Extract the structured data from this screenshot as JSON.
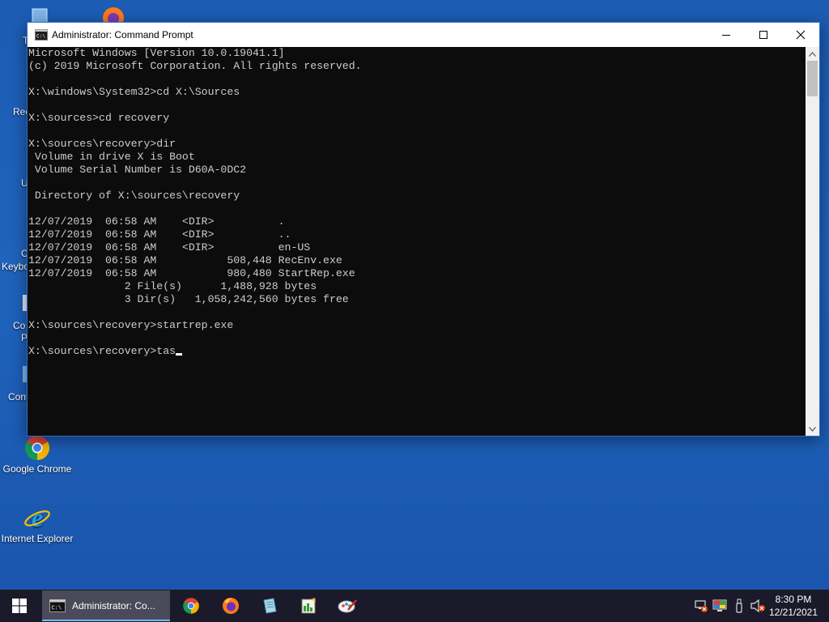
{
  "window": {
    "title": "Administrator: Command Prompt",
    "console_lines": [
      "Microsoft Windows [Version 10.0.19041.1]",
      "(c) 2019 Microsoft Corporation. All rights reserved.",
      "",
      "X:\\windows\\System32>cd X:\\Sources",
      "",
      "X:\\sources>cd recovery",
      "",
      "X:\\sources\\recovery>dir",
      " Volume in drive X is Boot",
      " Volume Serial Number is D60A-0DC2",
      "",
      " Directory of X:\\sources\\recovery",
      "",
      "12/07/2019  06:58 AM    <DIR>          .",
      "12/07/2019  06:58 AM    <DIR>          ..",
      "12/07/2019  06:58 AM    <DIR>          en-US",
      "12/07/2019  06:58 AM           508,448 RecEnv.exe",
      "12/07/2019  06:58 AM           980,480 StartRep.exe",
      "               2 File(s)      1,488,928 bytes",
      "               3 Dir(s)   1,058,242,560 bytes free",
      "",
      "X:\\sources\\recovery>startrep.exe",
      ""
    ],
    "prompt": "X:\\sources\\recovery>",
    "current_input": "tas"
  },
  "desktop": {
    "icons": [
      {
        "label": "Google Chrome",
        "icon": "chrome-icon"
      },
      {
        "label": "Internet Explorer",
        "icon": "internet-explorer-icon"
      }
    ],
    "partial_labels": [
      "T",
      "Rec",
      "U",
      "Keybo",
      "C",
      "Co",
      "P",
      "Cont"
    ]
  },
  "taskbar": {
    "active_task_label": "Administrator: Co...",
    "pinned": [
      "chrome-icon",
      "firefox-icon",
      "notepad-icon",
      "registry-editor-icon",
      "paint-icon"
    ],
    "tray": [
      "network-disconnected-icon",
      "display-icon",
      "usb-drive-icon",
      "volume-muted-icon"
    ],
    "clock_time": "8:30 PM",
    "clock_date": "12/21/2021"
  },
  "colors": {
    "desktop": "#1f63bd",
    "console_bg": "#0c0c0c",
    "console_text": "#cccccc",
    "taskbar": "#1a1a2a",
    "accent": "#76b9ed"
  }
}
